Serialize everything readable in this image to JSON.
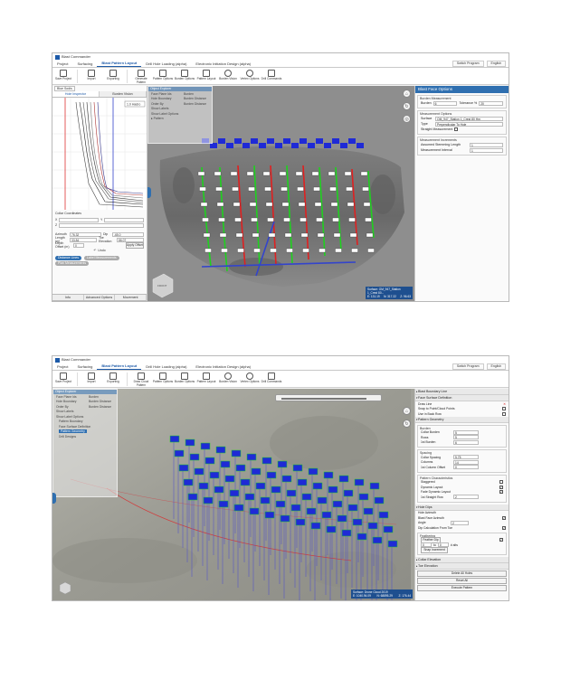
{
  "app": {
    "title": "Blast Commander"
  },
  "menu": {
    "items": [
      "Project",
      "Surfacing",
      "Blast Pattern Layout",
      "Drill Hole Loading (alpha)",
      "Electronic Initiation Design (alpha)"
    ],
    "active_index": 2,
    "switch_program": "Switch Program",
    "language": "English"
  },
  "ribbon1": {
    "items": [
      "Save Project",
      "Import",
      "Exporting",
      "Generate Pattern",
      "Pattern Options",
      "Burden Options",
      "Pattern Layout",
      "Burden Vision",
      "Vertex Options",
      "Drill Commands"
    ]
  },
  "ribbon2": {
    "items": [
      "Save Project",
      "Import",
      "Exporting",
      "Draw Cloud Pattern",
      "Pattern Options",
      "Burden Options",
      "Pattern Layout",
      "Burden Vision",
      "Vertex Options",
      "Drill Commands"
    ]
  },
  "left1": {
    "panel_title": "Blue Sodis",
    "tabs": [
      "Hole Inspector",
      "Burden Vision"
    ],
    "chart_label": "1.0 Hadro",
    "collar_coordinates_label": "Collar Coordinates",
    "x_label": "X",
    "y_label": "Y",
    "z_label": "Z",
    "azimuth_label": "Azimuth",
    "azimuth_value": "76.32",
    "dip_label": "Dip",
    "dip_value": "-65.0",
    "length_label": "Length (m)",
    "length_value": "33.84",
    "toe_label": "Toe Elevation",
    "toe_value": "86.07",
    "depth_label": "Depth Offset (m)",
    "depth_value": "0",
    "apply_offset": "Apply Offset",
    "undo_label": "Undo",
    "toggle_a": "Distance Lines",
    "toggle_b": "Label Measurements",
    "toggle_c": "Plan Measurements",
    "bottom_tabs": [
      "Info",
      "Advanced Options",
      "Movement"
    ]
  },
  "float1": {
    "title": "Object Explorer",
    "rows": [
      "Face Plane Ids",
      "Hole Boundary",
      "Order By",
      "Show Labels",
      "Show Label Options"
    ],
    "values": [
      "Burden",
      "Burden Distance",
      "Burden Distance"
    ],
    "tree_root": "Pattern"
  },
  "right1": {
    "header": "Blast Face Options",
    "sec1": "Burden Measurement",
    "burden_label": "Burden",
    "burden_value": "6",
    "tolerance_label": "Tolerance %",
    "tolerance_value": "20",
    "sec2": "Measurement Options",
    "surface_label": "Surface",
    "surface_value": "OM_947_Station 1_Crest 80 Hm",
    "type_label": "Type",
    "type_value": "Perpendicular To Hole",
    "straight_label": "Straight Measurement",
    "sec3": "Measurement Increments",
    "assumed_label": "Assumed Stemming Length",
    "assumed_value": "1",
    "interval_label": "Measurement Interval",
    "interval_value": "1"
  },
  "status1": {
    "surface_label": "Surface: OM_947_Station 1_Crest 80...",
    "x": "E: 131.19",
    "y": "N: 317.22",
    "z": "Z: 96.63"
  },
  "viewcube1": {
    "label": "FRONT"
  },
  "float2": {
    "title": "Object Explorer",
    "rows": [
      "Face Plane Ids",
      "Hole Boundary",
      "Order By",
      "Show Labels",
      "Show Label Options"
    ],
    "values": [
      "Burden",
      "Burden Distance",
      "Burden Distance"
    ],
    "tree": [
      "Pattern Boundary",
      "Face Surface Definition",
      "Pattern Geometry",
      "Drill Designs"
    ]
  },
  "right2": {
    "acc_blast_boundary": "Blast Boundary Line",
    "acc_face_surface": "Face Surface Definition",
    "draw_line": "Draw Line",
    "snap_point": "Snap to Point/Cloud Points",
    "use_in_back_row": "Use in Back Row",
    "acc_pattern_geometry": "Pattern Geometry",
    "burden_group": "Burden",
    "collar_burden_label": "Collar Burden",
    "collar_burden_value": "5",
    "rows_label": "Rows",
    "rows_value": "5",
    "first_burden_label": "1st Burden",
    "first_burden_value": "6",
    "spacing_group": "Spacing",
    "collar_spacing_label": "Collar Spacing",
    "collar_spacing_value": "5.75",
    "columns_label": "Columns",
    "columns_value": "14",
    "first_col_offset_label": "1st Column Offset",
    "first_col_offset_value": "0",
    "pattern_chars_group": "Pattern Characteristics",
    "staggered_label": "Staggered",
    "dynamic_layout_label": "Dynamic Layout",
    "fade_dynamic_label": "Fade Dynamic Layout",
    "straight_row_label": "1st Straight Row",
    "straight_row_value": "2",
    "acc_hole_dips": "Hole Dips",
    "hole_azimuth_label": "Hole Azimuth",
    "blast_face_azimuth_label": "Blast Face Azimuth",
    "angle_label": "Angle",
    "angle_value": "2",
    "dip_calc_label": "Dip Calculation From Toe",
    "feathering_group": "Feathering",
    "feather_dip_label": "Feather Dip",
    "feather_from": "0",
    "feather_to": "0",
    "feather_unit": "# alts",
    "snap_increment": "Snap Increment",
    "acc_collar_elevation": "Collar Elevation",
    "acc_toe_elevation": "Toe Elevation",
    "delete_all_holes": "Delete All Holes",
    "reset_all": "Reset All",
    "execute_pattern": "Execute Pattern"
  },
  "status2": {
    "surface_label": "Surface: Drone Cloud 2019",
    "x": "E: 1040.94.09",
    "y": "N: 68895.29",
    "z": "Z: 176.44"
  },
  "colors": {
    "accent": "#2f6fb0",
    "hole_label": "#1f2ad6",
    "green_line": "#1fd11f",
    "red_line": "#e02020"
  }
}
